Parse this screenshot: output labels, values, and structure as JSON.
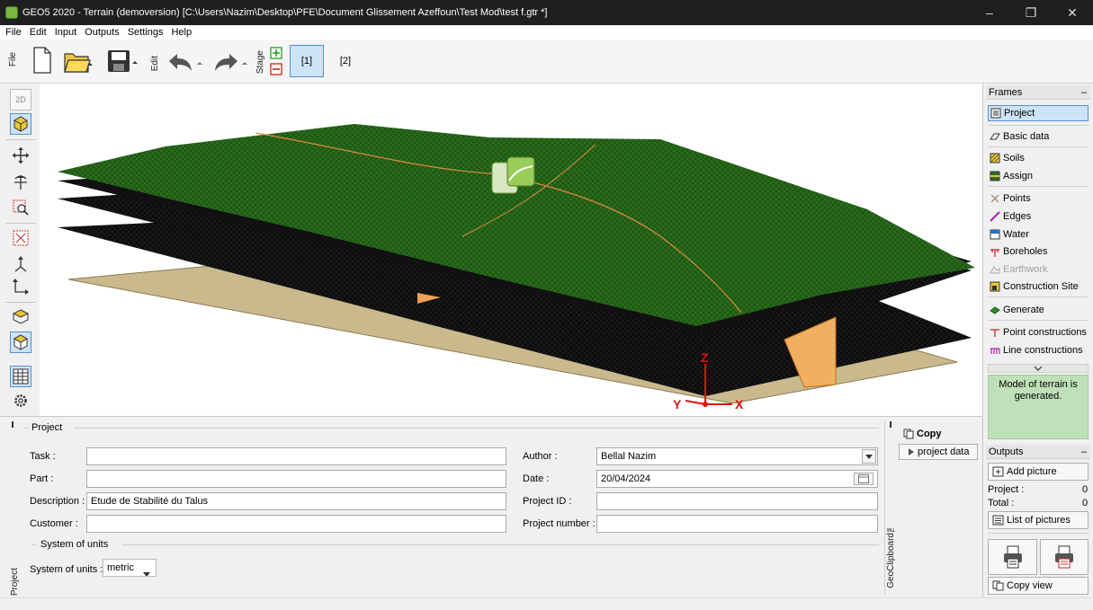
{
  "window": {
    "title": "GEO5 2020 - Terrain (demoversion) [C:\\Users\\Nazim\\Desktop\\PFE\\Document Glissement Azeffoun\\Test Mod\\test f.gtr *]",
    "minimize": "–",
    "restore": "❐",
    "close": "✕"
  },
  "menu": [
    "File",
    "Edit",
    "Input",
    "Outputs",
    "Settings",
    "Help"
  ],
  "toolbar": {
    "file_label": "File",
    "edit_label": "Edit",
    "stage_label": "Stage",
    "stages": [
      "[1]",
      "[2]"
    ]
  },
  "view": {
    "view2d_label": "2D",
    "axis_x": "X",
    "axis_y": "Y",
    "axis_z": "Z"
  },
  "frames": {
    "title": "Frames",
    "minimize": "–",
    "items": [
      {
        "label": "Project",
        "icon": "project-icon",
        "selected": true
      },
      {
        "label": "Basic data",
        "icon": "basic-data-icon"
      },
      {
        "label": "Soils",
        "icon": "soils-icon"
      },
      {
        "label": "Assign",
        "icon": "assign-icon"
      },
      {
        "label": "Points",
        "icon": "points-icon"
      },
      {
        "label": "Edges",
        "icon": "edges-icon"
      },
      {
        "label": "Water",
        "icon": "water-icon"
      },
      {
        "label": "Boreholes",
        "icon": "boreholes-icon"
      },
      {
        "label": "Earthwork",
        "icon": "earthwork-icon",
        "disabled": true
      },
      {
        "label": "Construction Site",
        "icon": "construction-site-icon"
      },
      {
        "label": "Generate",
        "icon": "generate-icon"
      },
      {
        "label": "Point constructions",
        "icon": "point-constructions-icon"
      },
      {
        "label": "Line constructions",
        "icon": "line-constructions-icon"
      }
    ],
    "message": "Model of terrain is generated.",
    "message_color": "#bfe0b8"
  },
  "outputs": {
    "title": "Outputs",
    "minimize": "–",
    "add_picture": "Add picture",
    "project_label": "Project :",
    "project_count": "0",
    "total_label": "Total :",
    "total_count": "0",
    "list_pictures": "List of pictures",
    "copy_view": "Copy view"
  },
  "project_form": {
    "side_label": "Project",
    "section_project": "Project",
    "task_label": "Task :",
    "task_value": "",
    "part_label": "Part :",
    "part_value": "",
    "description_label": "Description :",
    "description_value": "Etude de Stabilité du Talus",
    "customer_label": "Customer :",
    "customer_value": "",
    "author_label": "Author :",
    "author_value": "Bellal Nazim",
    "date_label": "Date :",
    "date_value": "20/04/2024",
    "project_id_label": "Project ID :",
    "project_id_value": "",
    "project_number_label": "Project number :",
    "project_number_value": "",
    "section_units": "System of units",
    "units_label": "System of units :",
    "units_value": "metric"
  },
  "geoclipboard": {
    "side_label": "GeoClipboard™",
    "copy_label": "Copy",
    "project_data": "project data"
  },
  "colors": {
    "terrain_green": "#1f5a14",
    "layer_black": "#0d0d0d",
    "base_plane": "#c9b98c",
    "accent_orange": "#f0a050",
    "axis_red": "#e01010",
    "selection_blue": "#cde3f7"
  }
}
